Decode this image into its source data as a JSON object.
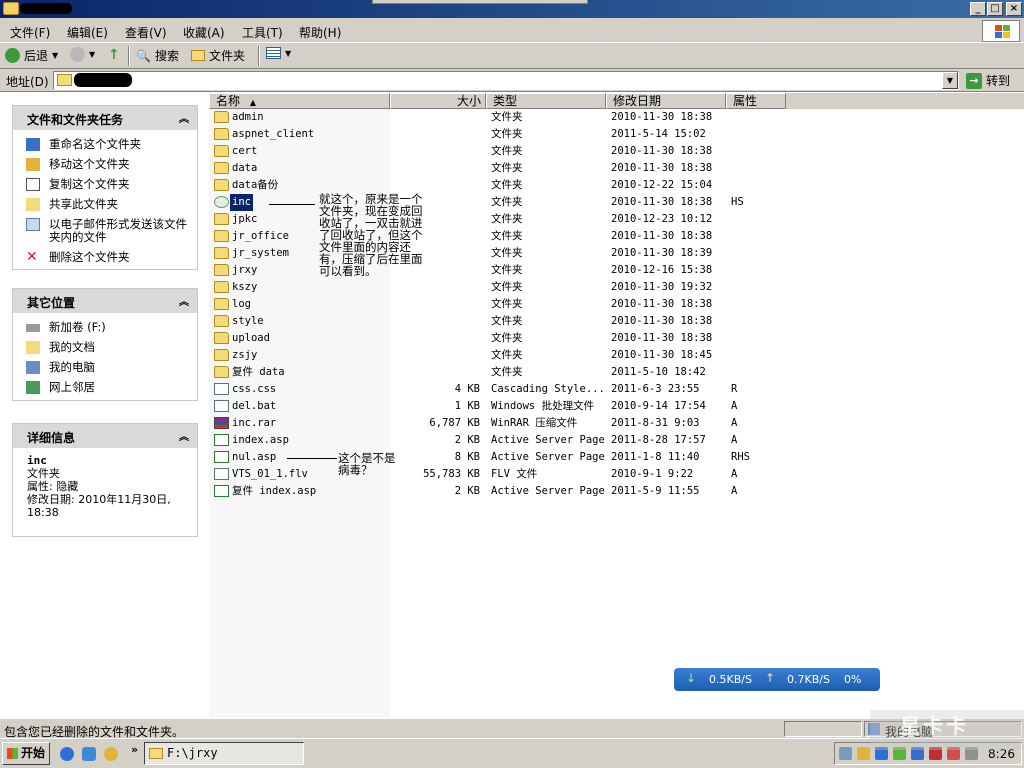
{
  "menubar": {
    "items": [
      "文件(F)",
      "编辑(E)",
      "查看(V)",
      "收藏(A)",
      "工具(T)",
      "帮助(H)"
    ]
  },
  "toolbar": {
    "back": "后退",
    "search": "搜索",
    "folders": "文件夹"
  },
  "address": {
    "label": "地址(D)",
    "go": "转到"
  },
  "taskpane": {
    "file_tasks": {
      "title": "文件和文件夹任务",
      "items": [
        "重命名这个文件夹",
        "移动这个文件夹",
        "复制这个文件夹",
        "共享此文件夹",
        "以电子邮件形式发送该文件夹内的文件",
        "删除这个文件夹"
      ]
    },
    "other_places": {
      "title": "其它位置",
      "items": [
        "新加卷 (F:)",
        "我的文档",
        "我的电脑",
        "网上邻居"
      ]
    },
    "details": {
      "title": "详细信息",
      "name": "inc",
      "type": "文件夹",
      "attributes": "属性: 隐藏",
      "modified": "修改日期: 2010年11月30日, 18:38"
    }
  },
  "listview": {
    "columns": [
      "名称",
      "大小",
      "类型",
      "修改日期",
      "属性"
    ],
    "rows": [
      {
        "icon": "folder",
        "name": "admin",
        "size": "",
        "type": "文件夹",
        "date": "2010-11-30 18:38",
        "attr": ""
      },
      {
        "icon": "folder",
        "name": "aspnet_client",
        "size": "",
        "type": "文件夹",
        "date": "2011-5-14 15:02",
        "attr": ""
      },
      {
        "icon": "folder",
        "name": "cert",
        "size": "",
        "type": "文件夹",
        "date": "2010-11-30 18:38",
        "attr": ""
      },
      {
        "icon": "folder",
        "name": "data",
        "size": "",
        "type": "文件夹",
        "date": "2010-11-30 18:38",
        "attr": ""
      },
      {
        "icon": "folder",
        "name": "data备份",
        "size": "",
        "type": "文件夹",
        "date": "2010-12-22 15:04",
        "attr": ""
      },
      {
        "icon": "recycle",
        "name": "inc",
        "size": "",
        "type": "文件夹",
        "date": "2010-11-30 18:38",
        "attr": "HS"
      },
      {
        "icon": "folder",
        "name": "jpkc",
        "size": "",
        "type": "文件夹",
        "date": "2010-12-23 10:12",
        "attr": ""
      },
      {
        "icon": "folder",
        "name": "jr_office",
        "size": "",
        "type": "文件夹",
        "date": "2010-11-30 18:38",
        "attr": ""
      },
      {
        "icon": "folder",
        "name": "jr_system",
        "size": "",
        "type": "文件夹",
        "date": "2010-11-30 18:39",
        "attr": ""
      },
      {
        "icon": "folder",
        "name": "jrxy",
        "size": "",
        "type": "文件夹",
        "date": "2010-12-16 15:38",
        "attr": ""
      },
      {
        "icon": "folder",
        "name": "kszy",
        "size": "",
        "type": "文件夹",
        "date": "2010-11-30 19:32",
        "attr": ""
      },
      {
        "icon": "folder",
        "name": "log",
        "size": "",
        "type": "文件夹",
        "date": "2010-11-30 18:38",
        "attr": ""
      },
      {
        "icon": "folder",
        "name": "style",
        "size": "",
        "type": "文件夹",
        "date": "2010-11-30 18:38",
        "attr": ""
      },
      {
        "icon": "folder",
        "name": "upload",
        "size": "",
        "type": "文件夹",
        "date": "2010-11-30 18:38",
        "attr": ""
      },
      {
        "icon": "folder",
        "name": "zsjy",
        "size": "",
        "type": "文件夹",
        "date": "2010-11-30 18:45",
        "attr": ""
      },
      {
        "icon": "folder",
        "name": "复件 data",
        "size": "",
        "type": "文件夹",
        "date": "2011-5-10 18:42",
        "attr": ""
      },
      {
        "icon": "file",
        "name": "css.css",
        "size": "4 KB",
        "type": "Cascading Style...",
        "date": "2011-6-3 23:55",
        "attr": "R"
      },
      {
        "icon": "file",
        "name": "del.bat",
        "size": "1 KB",
        "type": "Windows 批处理文件",
        "date": "2010-9-14 17:54",
        "attr": "A"
      },
      {
        "icon": "rar",
        "name": "inc.rar",
        "size": "6,787 KB",
        "type": "WinRAR 压缩文件",
        "date": "2011-8-31 9:03",
        "attr": "A"
      },
      {
        "icon": "asp",
        "name": "index.asp",
        "size": "2 KB",
        "type": "Active Server Page",
        "date": "2011-8-28 17:57",
        "attr": "A"
      },
      {
        "icon": "asp",
        "name": "nul.asp",
        "size": "8 KB",
        "type": "Active Server Page",
        "date": "2011-1-8 11:40",
        "attr": "RHS"
      },
      {
        "icon": "file",
        "name": "VTS_01_1.flv",
        "size": "55,783 KB",
        "type": "FLV 文件",
        "date": "2010-9-1 9:22",
        "attr": "A"
      },
      {
        "icon": "asp",
        "name": "复件 index.asp",
        "size": "2 KB",
        "type": "Active Server Page",
        "date": "2011-5-9 11:55",
        "attr": "A"
      }
    ]
  },
  "annotations": {
    "inc_note": "就这个，原来是一个文件夹，现在变成回收站了，一双击就进了回收站了，但这个文件里面的内容还有，压缩了后在里面可以看到。",
    "nul_note": "这个是不是病毒？"
  },
  "network": {
    "down": "0.5KB/S",
    "up": "0.7KB/S",
    "percent": "0%"
  },
  "statusbar": {
    "text": "包含您已经删除的文件和文件夹。",
    "location": "我的电脑"
  },
  "taskbar": {
    "start": "开始",
    "task": "F:\\jrxy",
    "clock": "8:26"
  },
  "watermark": "星卡卡"
}
